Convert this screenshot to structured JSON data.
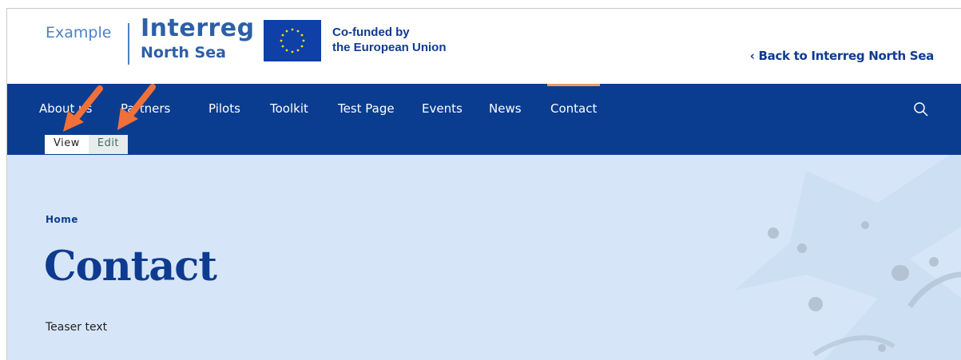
{
  "header": {
    "logo_example": "Example",
    "logo_interreg": "Interreg",
    "logo_north_sea": "North Sea",
    "eu_line1": "Co-funded by",
    "eu_line2": "the European Union",
    "back_link": "‹ Back to Interreg North Sea"
  },
  "nav": {
    "items": [
      {
        "label": "About us"
      },
      {
        "label": "Partners"
      },
      {
        "label": "Pilots"
      },
      {
        "label": "Toolkit"
      },
      {
        "label": "Test Page"
      },
      {
        "label": "Events"
      },
      {
        "label": "News"
      },
      {
        "label": "Contact"
      }
    ],
    "active": "Contact",
    "search_icon": "search-icon"
  },
  "tabs": {
    "view": "View",
    "edit": "Edit"
  },
  "hero": {
    "breadcrumb": "Home",
    "title": "Contact",
    "teaser": "Teaser text"
  },
  "colors": {
    "nav_bg": "#0a3d8f",
    "hero_bg": "#d6e6f8",
    "accent": "#e89a6e",
    "title": "#0e3b90",
    "arrow": "#f0703a"
  }
}
